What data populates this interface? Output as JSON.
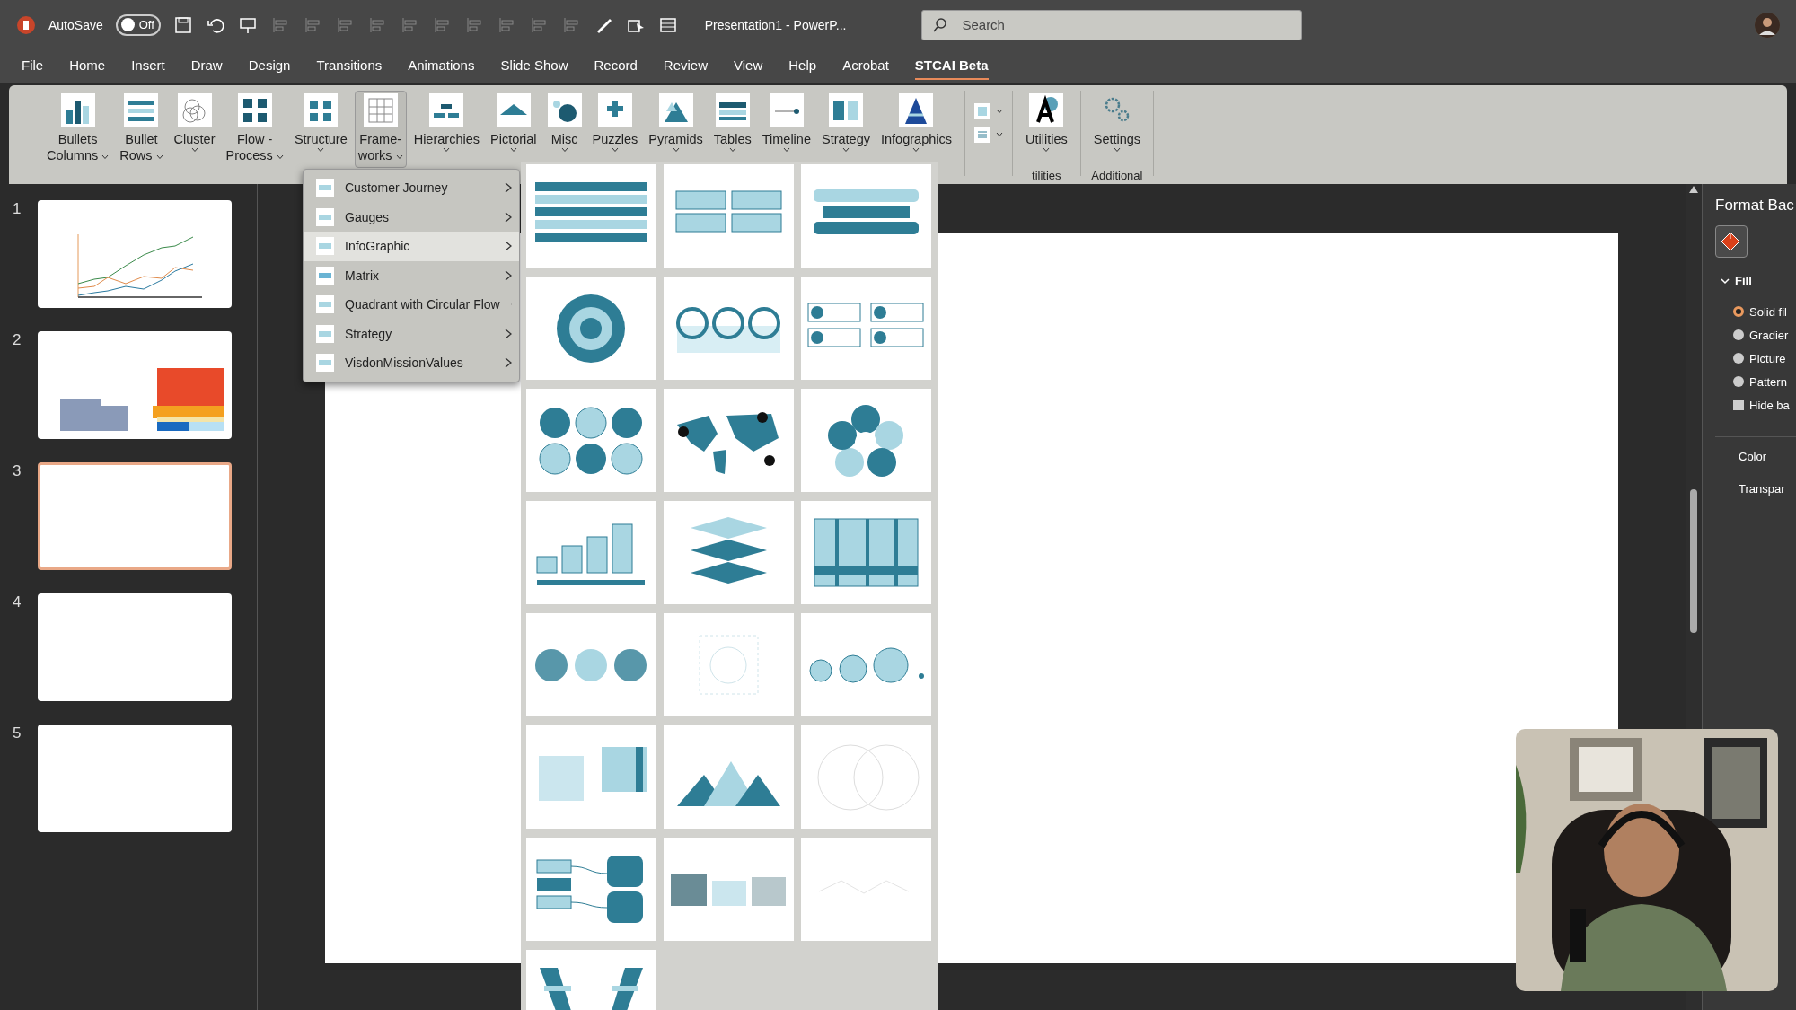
{
  "title_bar": {
    "autosave": {
      "label": "AutoSave",
      "on": false,
      "state_text": "Off"
    },
    "document_title": "Presentation1  -  PowerP...",
    "search": {
      "placeholder": "Search"
    }
  },
  "menu_tabs": [
    {
      "label": "File",
      "selected": false
    },
    {
      "label": "Home",
      "selected": false
    },
    {
      "label": "Insert",
      "selected": false
    },
    {
      "label": "Draw",
      "selected": false
    },
    {
      "label": "Design",
      "selected": false
    },
    {
      "label": "Transitions",
      "selected": false
    },
    {
      "label": "Animations",
      "selected": false
    },
    {
      "label": "Slide Show",
      "selected": false
    },
    {
      "label": "Record",
      "selected": false
    },
    {
      "label": "Review",
      "selected": false
    },
    {
      "label": "View",
      "selected": false
    },
    {
      "label": "Help",
      "selected": false
    },
    {
      "label": "Acrobat",
      "selected": false
    },
    {
      "label": "STCAI Beta",
      "selected": true
    }
  ],
  "ribbon": {
    "buttons": [
      {
        "lines": [
          "Bullets",
          "Columns"
        ],
        "selected": false
      },
      {
        "lines": [
          "Bullet",
          "Rows"
        ],
        "selected": false
      },
      {
        "lines": [
          "Cluster"
        ],
        "selected": false
      },
      {
        "lines": [
          "Flow -",
          "Process"
        ],
        "selected": false
      },
      {
        "lines": [
          "Structure"
        ],
        "selected": false
      },
      {
        "lines": [
          "Frame-",
          "works"
        ],
        "selected": true
      },
      {
        "lines": [
          "Hierarchies"
        ],
        "selected": false
      },
      {
        "lines": [
          "Pictorial"
        ],
        "selected": false
      },
      {
        "lines": [
          "Misc"
        ],
        "selected": false
      },
      {
        "lines": [
          "Puzzles"
        ],
        "selected": false
      },
      {
        "lines": [
          "Pyramids"
        ],
        "selected": false
      },
      {
        "lines": [
          "Tables"
        ],
        "selected": false
      },
      {
        "lines": [
          "Timeline"
        ],
        "selected": false
      },
      {
        "lines": [
          "Strategy"
        ],
        "selected": false
      },
      {
        "lines": [
          "Infographics"
        ],
        "selected": false
      }
    ],
    "utilities_button": {
      "lines": [
        "Utilities"
      ]
    },
    "utilities_group_label": "tilities",
    "settings_button": {
      "lines": [
        "Settings"
      ]
    },
    "additional_group_label": "Additional"
  },
  "dropdown_menu": {
    "items": [
      {
        "label": "Customer Journey",
        "selected": false
      },
      {
        "label": "Gauges",
        "selected": false
      },
      {
        "label": "InfoGraphic",
        "selected": true
      },
      {
        "label": "Matrix",
        "selected": false
      },
      {
        "label": "Quadrant with Circular Flow",
        "selected": false
      },
      {
        "label": "Strategy",
        "selected": false
      },
      {
        "label": "VisdonMissionValues",
        "selected": false
      }
    ]
  },
  "gallery": {
    "tiles": [
      {
        "kind": "table"
      },
      {
        "kind": "banners"
      },
      {
        "kind": "arrows"
      },
      {
        "kind": "ring"
      },
      {
        "kind": "circles"
      },
      {
        "kind": "boxes"
      },
      {
        "kind": "petals"
      },
      {
        "kind": "map"
      },
      {
        "kind": "flower"
      },
      {
        "kind": "steps"
      },
      {
        "kind": "layers"
      },
      {
        "kind": "columns"
      },
      {
        "kind": "clusters"
      },
      {
        "kind": "faint"
      },
      {
        "kind": "bubbles"
      },
      {
        "kind": "dotgrid"
      },
      {
        "kind": "mountains"
      },
      {
        "kind": "venn"
      },
      {
        "kind": "flow"
      },
      {
        "kind": "dotmatrix"
      },
      {
        "kind": "zigzag"
      },
      {
        "kind": "funnel"
      }
    ]
  },
  "slides": [
    {
      "number": "1",
      "kind": "line-chart",
      "selected": false
    },
    {
      "number": "2",
      "kind": "waffle",
      "selected": false
    },
    {
      "number": "3",
      "kind": "blank",
      "selected": true
    },
    {
      "number": "4",
      "kind": "blank",
      "selected": false
    },
    {
      "number": "5",
      "kind": "blank",
      "selected": false
    }
  ],
  "format_pane": {
    "title": "Format Bac",
    "section": {
      "label": "Fill",
      "expanded": true
    },
    "options": [
      {
        "kind": "radio",
        "label": "Solid fil",
        "selected": true
      },
      {
        "kind": "radio",
        "label": "Gradier",
        "selected": false
      },
      {
        "kind": "radio",
        "label": "Picture",
        "selected": false
      },
      {
        "kind": "radio",
        "label": "Pattern",
        "selected": false
      },
      {
        "kind": "checkbox",
        "label": "Hide ba",
        "checked": false
      }
    ],
    "fields": [
      "Color",
      "Transpar"
    ]
  }
}
